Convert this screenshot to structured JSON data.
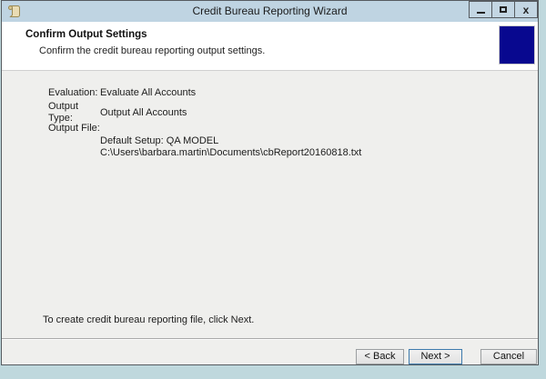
{
  "window": {
    "title": "Credit Bureau Reporting Wizard",
    "controls": {
      "close_glyph": "x"
    }
  },
  "header": {
    "title": "Confirm Output Settings",
    "subtitle": "Confirm the credit bureau reporting output settings."
  },
  "content": {
    "fields": [
      {
        "label": "Evaluation:",
        "value": "Evaluate All Accounts"
      },
      {
        "label": "Output Type:",
        "value": "Output All Accounts"
      },
      {
        "label": "Output File:",
        "value": ""
      }
    ],
    "output_file_lines": [
      "Default Setup: QA MODEL",
      "C:\\Users\\barbara.martin\\Documents\\cbReport20160818.txt"
    ],
    "instruction": "To create credit bureau reporting file, click Next."
  },
  "buttons": {
    "back": "< Back",
    "next": "Next >",
    "cancel": "Cancel"
  }
}
